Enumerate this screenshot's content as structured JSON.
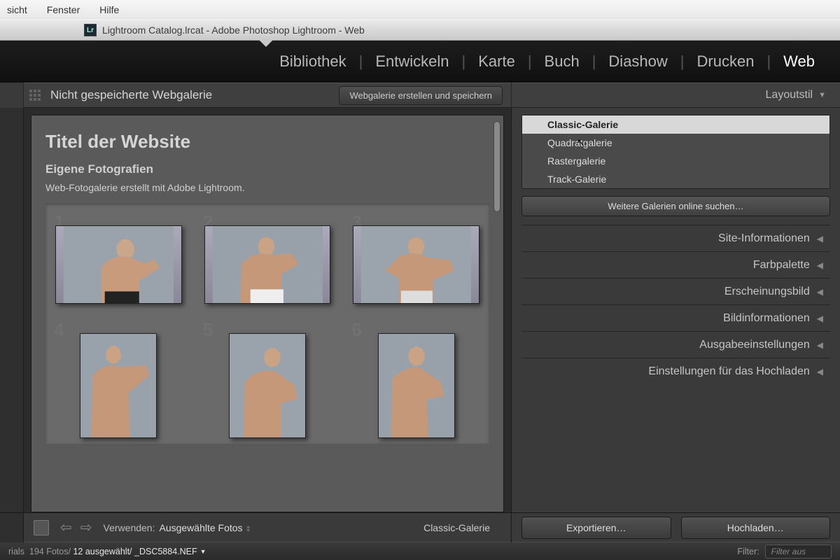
{
  "mac_menu": {
    "view": "sicht",
    "window": "Fenster",
    "help": "Hilfe"
  },
  "titlebar": {
    "icon": "Lr",
    "text": "Lightroom Catalog.lrcat - Adobe Photoshop Lightroom - Web"
  },
  "modules": {
    "library": "Bibliothek",
    "develop": "Entwickeln",
    "map": "Karte",
    "book": "Buch",
    "slideshow": "Diashow",
    "print": "Drucken",
    "web": "Web"
  },
  "toolbar": {
    "title": "Nicht gespeicherte Webgalerie",
    "save_btn": "Webgalerie erstellen und speichern",
    "right_title": "Layoutstil"
  },
  "preview": {
    "site_title": "Titel der Website",
    "collection": "Eigene Fotografien",
    "desc": "Web-Fotogalerie erstellt mit Adobe Lightroom.",
    "cells": [
      "1",
      "2",
      "3",
      "4",
      "5",
      "6"
    ]
  },
  "layout_styles": {
    "items": [
      "Classic-Galerie",
      "Quadratgalerie",
      "Rastergalerie",
      "Track-Galerie"
    ],
    "more": "Weitere Galerien online suchen…"
  },
  "sections": [
    "Site-Informationen",
    "Farbpalette",
    "Erscheinungsbild",
    "Bildinformationen",
    "Ausgabeeinstellungen",
    "Einstellungen für das Hochladen"
  ],
  "bottom": {
    "use_label": "Verwenden:",
    "use_value": "Ausgewählte Fotos",
    "style": "Classic-Galerie",
    "export": "Exportieren…",
    "upload": "Hochladen…"
  },
  "status": {
    "left": "rials",
    "count": "194 Fotos/",
    "selected": "12 ausgewählt/",
    "file": "_DSC5884.NEF",
    "filter_label": "Filter:",
    "filter_value": "Filter aus"
  }
}
